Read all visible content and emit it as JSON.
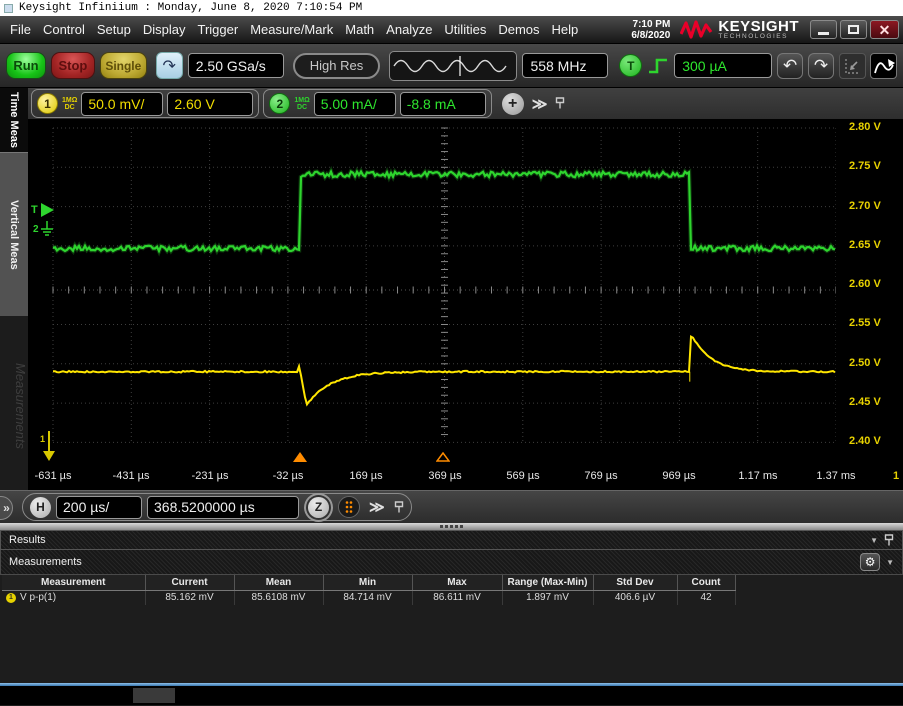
{
  "window": {
    "title": "Keysight Infiniium : Monday, June 8, 2020 7:10:54 PM"
  },
  "menu": {
    "items": [
      "File",
      "Control",
      "Setup",
      "Display",
      "Trigger",
      "Measure/Mark",
      "Math",
      "Analyze",
      "Utilities",
      "Demos",
      "Help"
    ],
    "clock": {
      "time": "7:10 PM",
      "date": "6/8/2020"
    },
    "brand": {
      "name": "KEYSIGHT",
      "sub": "TECHNOLOGIES"
    }
  },
  "toolbar": {
    "run_label": "Run",
    "stop_label": "Stop",
    "single_label": "Single",
    "sample_rate": "2.50 GSa/s",
    "acq_mode": "High Res",
    "bandwidth": "558 MHz",
    "trigger_letter": "T",
    "trigger_level": "300 µA"
  },
  "channels": {
    "ch1": {
      "number": "1",
      "impedance": "1MΩ",
      "coupling": "DC",
      "scale": "50.0 mV/",
      "offset": "2.60 V",
      "color": "#ffe600"
    },
    "ch2": {
      "number": "2",
      "impedance": "1MΩ",
      "coupling": "DC",
      "scale": "5.00 mA/",
      "offset": "-8.8 mA",
      "color": "#2ed52e"
    }
  },
  "sidebar": {
    "tab1": "Time Meas",
    "tab2": "Vertical Meas",
    "watermark": "Measurements"
  },
  "horizontal": {
    "label": "H",
    "scale": "200 µs/",
    "position": "368.5200000 µs",
    "zoom_label": "Z"
  },
  "results": {
    "panel_title": "Results",
    "section_title": "Measurements"
  },
  "table": {
    "headers": [
      "Measurement",
      "Current",
      "Mean",
      "Min",
      "Max",
      "Range (Max-Min)",
      "Std Dev",
      "Count"
    ],
    "row": {
      "marker": "1",
      "name": "V p-p(1)",
      "values": [
        "85.162 mV",
        "85.6108 mV",
        "84.714 mV",
        "86.611 mV",
        "1.897 mV",
        "406.6 µV",
        "42"
      ]
    }
  },
  "axes": {
    "voltage_labels": [
      "2.80 V",
      "2.75 V",
      "2.70 V",
      "2.65 V",
      "2.60 V",
      "2.55 V",
      "2.50 V",
      "2.45 V",
      "2.40 V"
    ],
    "time_labels": [
      "-631 µs",
      "-431 µs",
      "-231 µs",
      "-32 µs",
      "169 µs",
      "369 µs",
      "569 µs",
      "769 µs",
      "969 µs",
      "1.17 ms",
      "1.37 ms"
    ],
    "right_edge_label": "1",
    "trigger_marker_letter": "T",
    "trigger_marker_channel": "2",
    "ground_marker_channel": "1"
  },
  "icons": {
    "minimize": "",
    "maximize": "",
    "close": "✕",
    "touch_arrow": "↷",
    "undo": "↶",
    "redo": "↷",
    "plus": "+",
    "chevrons": "≫",
    "gear": "⚙",
    "dropdown": "▼",
    "half_chevrons": "»"
  },
  "colors": {
    "ch1_yellow": "#ffe600",
    "ch2_green": "#2ed52e",
    "marker_orange": "#ff8c00",
    "brand_red": "#e90029",
    "accent_blue": "#5a9fd4"
  },
  "chart_data": {
    "type": "line",
    "title": "Oscilloscope grid with channel 1 voltage and channel 2 current traces",
    "x_axis": {
      "tick_labels": [
        "-631 µs",
        "-431 µs",
        "-231 µs",
        "-32 µs",
        "169 µs",
        "369 µs",
        "569 µs",
        "769 µs",
        "969 µs",
        "1.17 ms",
        "1.37 ms"
      ],
      "time_per_div": "200 µs/",
      "range_us": [
        -631.48,
        1368.52
      ],
      "divisions": 10
    },
    "y_axis": {
      "tick_labels": [
        "2.80 V",
        "2.75 V",
        "2.70 V",
        "2.65 V",
        "2.60 V",
        "2.55 V",
        "2.50 V",
        "2.45 V",
        "2.40 V"
      ],
      "volts_per_div": 0.05,
      "range_v": [
        2.4,
        2.8
      ],
      "divisions": 8
    },
    "series": [
      {
        "name": "channel-2",
        "color": "#2ed52e",
        "shape": "square-step",
        "level_low_v": 2.647,
        "level_high_v": 2.741,
        "step_up_at_us": 0,
        "step_down_at_us": 995,
        "noise_pp_v": 0.007
      },
      {
        "name": "channel-1",
        "color": "#ffe600",
        "shape": "flat-with-transients",
        "baseline_v": 2.49,
        "dip": {
          "at_us": 0,
          "min_v": 2.447,
          "recover_tau_us": 60
        },
        "spike": {
          "at_us": 995,
          "peak_v": 2.535,
          "decay_tau_us": 48
        },
        "noise_pp_v": 0.002
      }
    ],
    "markers": {
      "trigger_time_us": 0,
      "horiz_ref_time_us": 368.52
    },
    "grid": "dashed"
  }
}
